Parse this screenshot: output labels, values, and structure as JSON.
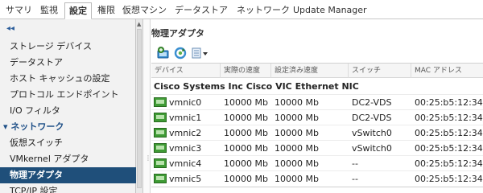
{
  "tabs": [
    {
      "label": "サマリ",
      "active": false
    },
    {
      "label": "監視",
      "active": false
    },
    {
      "label": "設定",
      "active": true
    },
    {
      "label": "権限",
      "active": false
    },
    {
      "label": "仮想マシン",
      "active": false
    },
    {
      "label": "データストア",
      "active": false
    },
    {
      "label": "ネットワーク",
      "active": false
    },
    {
      "label": "Update Manager",
      "active": false
    }
  ],
  "sidebar": {
    "collapse_glyph": "◂◂",
    "items": [
      {
        "label": "ストレージ デバイス"
      },
      {
        "label": "データストア"
      },
      {
        "label": "ホスト キャッシュの設定"
      },
      {
        "label": "プロトコル エンドポイント"
      },
      {
        "label": "I/O フィルタ"
      },
      {
        "label": "▾ ネットワーク"
      },
      {
        "label": "仮想スイッチ"
      },
      {
        "label": "VMkernel アダプタ"
      },
      {
        "label": "物理アダプタ"
      },
      {
        "label": "TCP/IP 設定"
      }
    ]
  },
  "main": {
    "title": "物理アダプタ",
    "toolbar": {
      "icons": [
        "add-network-icon",
        "refresh-icon",
        "view-settings-icon"
      ]
    },
    "table": {
      "columns": [
        "デバイス",
        "実際の速度",
        "設定済み速度",
        "スイッチ",
        "MAC アドレス"
      ],
      "group_label": "Cisco Systems Inc Cisco VIC Ethernet NIC",
      "rows": [
        {
          "device": "vmnic0",
          "actual_speed": "10000 Mb",
          "configured_speed": "10000 Mb",
          "switch": "DC2-VDS",
          "mac": "00:25:b5:12:34..."
        },
        {
          "device": "vmnic1",
          "actual_speed": "10000 Mb",
          "configured_speed": "10000 Mb",
          "switch": "DC2-VDS",
          "mac": "00:25:b5:12:34..."
        },
        {
          "device": "vmnic2",
          "actual_speed": "10000 Mb",
          "configured_speed": "10000 Mb",
          "switch": "vSwitch0",
          "mac": "00:25:b5:12:34..."
        },
        {
          "device": "vmnic3",
          "actual_speed": "10000 Mb",
          "configured_speed": "10000 Mb",
          "switch": "vSwitch0",
          "mac": "00:25:b5:12:34..."
        },
        {
          "device": "vmnic4",
          "actual_speed": "10000 Mb",
          "configured_speed": "10000 Mb",
          "switch": "--",
          "mac": "00:25:b5:12:34..."
        },
        {
          "device": "vmnic5",
          "actual_speed": "10000 Mb",
          "configured_speed": "10000 Mb",
          "switch": "--",
          "mac": "00:25:b5:12:34..."
        }
      ]
    }
  },
  "colors": {
    "nav_selected_bg": "#1f4f7a",
    "section_blue": "#1e4f87",
    "nic_green": "#3f9b35"
  }
}
